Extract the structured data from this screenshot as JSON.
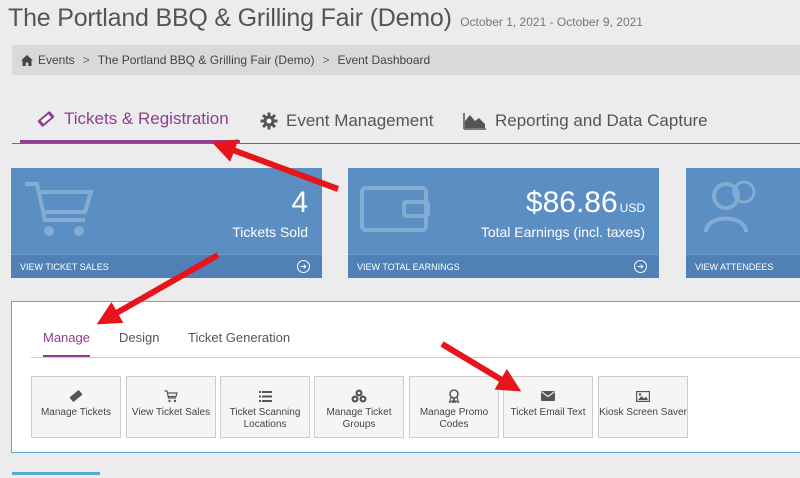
{
  "header": {
    "title": "The Portland BBQ & Grilling Fair (Demo)",
    "dates": "October 1, 2021 - October 9, 2021"
  },
  "breadcrumb": {
    "home": "Events",
    "event": "The Portland BBQ & Grilling Fair (Demo)",
    "current": "Event Dashboard",
    "separator": ">"
  },
  "main_tabs": [
    {
      "label": "Tickets & Registration",
      "icon": "ticket-icon",
      "active": true
    },
    {
      "label": "Event Management",
      "icon": "gear-icon",
      "active": false
    },
    {
      "label": "Reporting and Data Capture",
      "icon": "area-chart-icon",
      "active": false
    }
  ],
  "cards": [
    {
      "value": "4",
      "label": "Tickets Sold",
      "footer": "VIEW TICKET SALES",
      "icon": "cart-icon"
    },
    {
      "value": "$86.86",
      "unit": "USD",
      "label": "Total Earnings (incl. taxes)",
      "footer": "VIEW TOTAL EARNINGS",
      "icon": "wallet-icon"
    },
    {
      "value": "",
      "label": "",
      "footer": "VIEW ATTENDEES",
      "icon": "users-icon"
    }
  ],
  "sub_tabs": [
    {
      "label": "Manage",
      "active": true
    },
    {
      "label": "Design",
      "active": false
    },
    {
      "label": "Ticket Generation",
      "active": false
    }
  ],
  "tiles": [
    {
      "label": "Manage Tickets",
      "icon": "ticket-icon"
    },
    {
      "label": "View Ticket Sales",
      "icon": "cart-icon"
    },
    {
      "label": "Ticket Scanning Locations",
      "icon": "list-icon"
    },
    {
      "label": "Manage Ticket Groups",
      "icon": "cubes-icon"
    },
    {
      "label": "Manage Promo Codes",
      "icon": "certificate-icon"
    },
    {
      "label": "Ticket Email Text",
      "icon": "envelope-icon"
    },
    {
      "label": "Kiosk Screen Saver",
      "icon": "image-icon"
    }
  ],
  "colors": {
    "accent_purple": "#8e3e91",
    "card_blue": "#5b8fc4",
    "annotation_red": "#e8141b",
    "panel_border": "#5aa9d3"
  }
}
